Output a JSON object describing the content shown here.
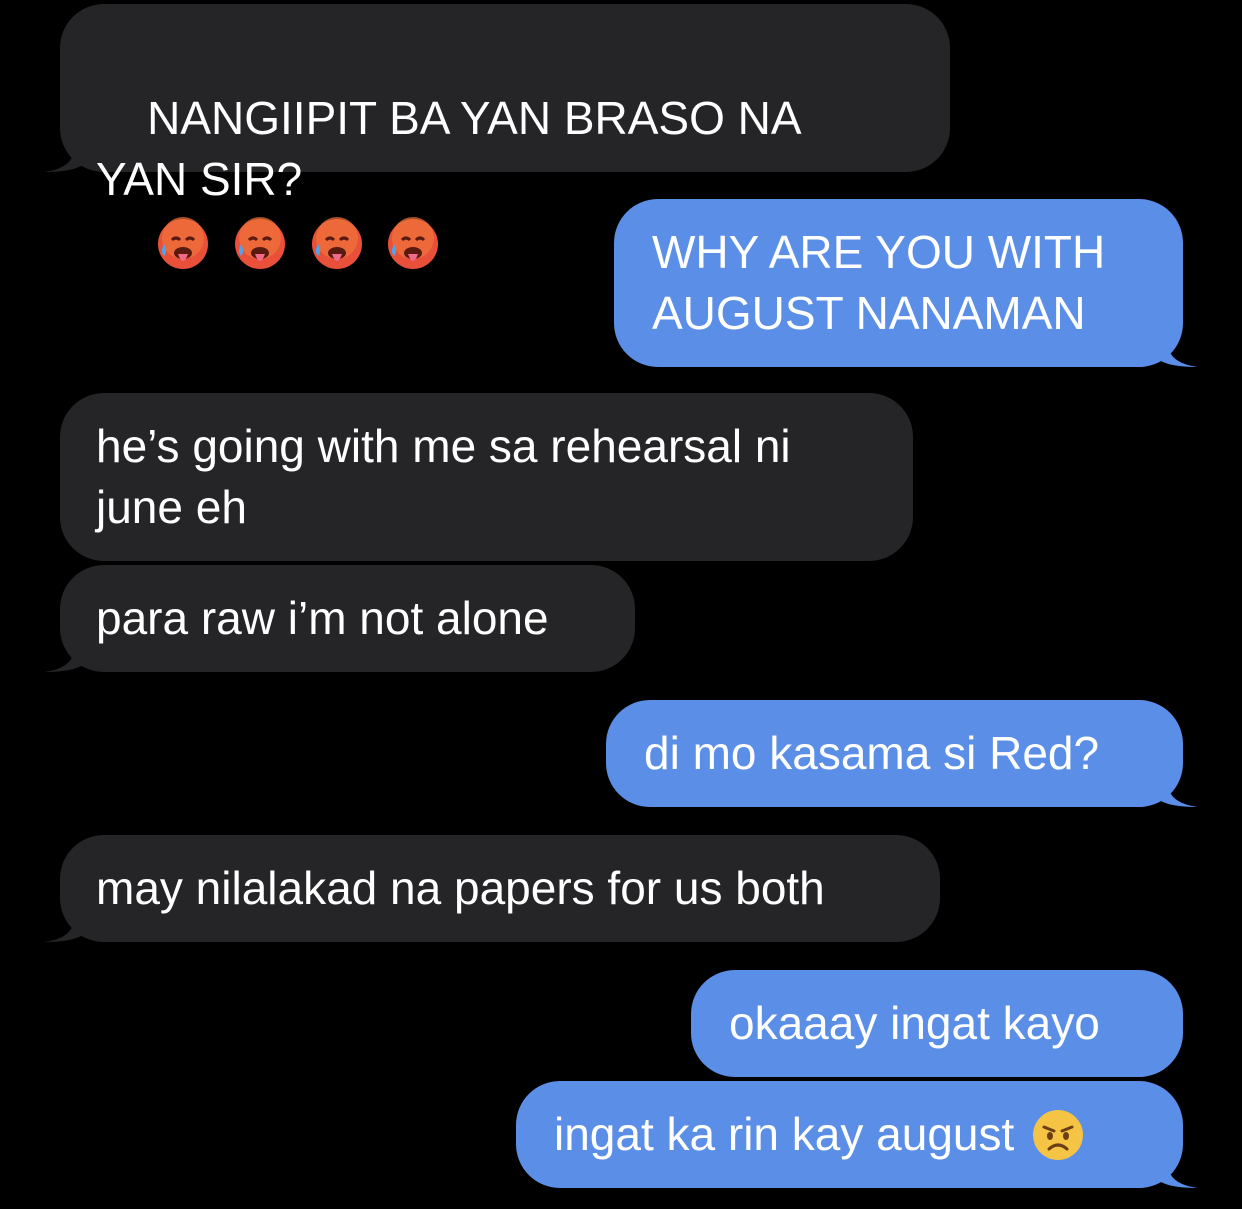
{
  "colors": {
    "background": "#000000",
    "received_bubble": "#252528",
    "sent_bubble": "#5b8ee7",
    "text": "#ffffff"
  },
  "messages": [
    {
      "side": "received",
      "text": "NANGIIPIT BA YAN BRASO NA YAN SIR?",
      "emojis": [
        "hot-face-icon",
        "hot-face-icon",
        "hot-face-icon",
        "hot-face-icon"
      ]
    },
    {
      "side": "sent",
      "text": "WHY ARE YOU WITH AUGUST NANAMAN"
    },
    {
      "side": "received",
      "text": "he’s going with me sa rehearsal ni june eh"
    },
    {
      "side": "received",
      "text": "para raw i’m not alone"
    },
    {
      "side": "sent",
      "text": "di mo kasama si Red?"
    },
    {
      "side": "received",
      "text": "may nilalakad na papers for us both"
    },
    {
      "side": "sent",
      "text": "okaaay ingat kayo"
    },
    {
      "side": "sent",
      "text": "ingat ka rin kay august",
      "emojis": [
        "angry-face-icon"
      ]
    }
  ]
}
